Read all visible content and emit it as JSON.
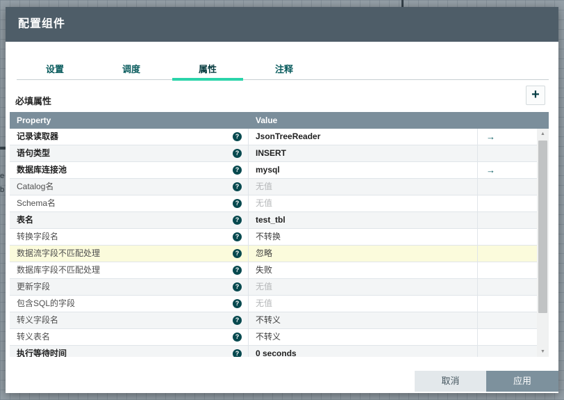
{
  "window": {
    "title": "配置组件"
  },
  "tabs": [
    {
      "id": "settings",
      "label": "设置",
      "active": false
    },
    {
      "id": "scheduling",
      "label": "调度",
      "active": false
    },
    {
      "id": "properties",
      "label": "属性",
      "active": true
    },
    {
      "id": "comments",
      "label": "注释",
      "active": false
    }
  ],
  "section": {
    "label": "必填属性",
    "add_button": "+"
  },
  "table": {
    "headers": [
      "Property",
      "Value"
    ],
    "rows": [
      {
        "name": "记录读取器",
        "bold": true,
        "value": "JsonTreeReader",
        "value_bold": true,
        "muted": false,
        "arrow": true,
        "highlight": false
      },
      {
        "name": "语句类型",
        "bold": true,
        "value": "INSERT",
        "value_bold": true,
        "muted": false,
        "arrow": false,
        "highlight": false
      },
      {
        "name": "数据库连接池",
        "bold": true,
        "value": "mysql",
        "value_bold": true,
        "muted": false,
        "arrow": true,
        "highlight": false
      },
      {
        "name": "Catalog名",
        "bold": false,
        "value": "无值",
        "value_bold": false,
        "muted": true,
        "arrow": false,
        "highlight": false
      },
      {
        "name": "Schema名",
        "bold": false,
        "value": "无值",
        "value_bold": false,
        "muted": true,
        "arrow": false,
        "highlight": false
      },
      {
        "name": "表名",
        "bold": true,
        "value": "test_tbl",
        "value_bold": true,
        "muted": false,
        "arrow": false,
        "highlight": false
      },
      {
        "name": "转换字段名",
        "bold": false,
        "value": "不转换",
        "value_bold": false,
        "muted": false,
        "arrow": false,
        "highlight": false
      },
      {
        "name": "数据流字段不匹配处理",
        "bold": false,
        "value": "忽略",
        "value_bold": false,
        "muted": false,
        "arrow": false,
        "highlight": true
      },
      {
        "name": "数据库字段不匹配处理",
        "bold": false,
        "value": "失败",
        "value_bold": false,
        "muted": false,
        "arrow": false,
        "highlight": false
      },
      {
        "name": "更新字段",
        "bold": false,
        "value": "无值",
        "value_bold": false,
        "muted": true,
        "arrow": false,
        "highlight": false
      },
      {
        "name": "包含SQL的字段",
        "bold": false,
        "value": "无值",
        "value_bold": false,
        "muted": true,
        "arrow": false,
        "highlight": false
      },
      {
        "name": "转义字段名",
        "bold": false,
        "value": "不转义",
        "value_bold": false,
        "muted": false,
        "arrow": false,
        "highlight": false
      },
      {
        "name": "转义表名",
        "bold": false,
        "value": "不转义",
        "value_bold": false,
        "muted": false,
        "arrow": false,
        "highlight": false
      },
      {
        "name": "执行等待时间",
        "bold": true,
        "value": "0 seconds",
        "value_bold": true,
        "muted": false,
        "arrow": false,
        "highlight": false
      }
    ]
  },
  "icons": {
    "help": "?",
    "arrow": "→",
    "add": "+",
    "scroll_up": "▲",
    "scroll_down": "▼"
  },
  "buttons": {
    "cancel": "取消",
    "apply": "应用"
  },
  "canvas_fragments": [
    "e",
    "b"
  ],
  "colors": {
    "dialog_header_bg": "#4e5d68",
    "table_header_bg": "#7b8e9b",
    "accent_teal": "#2bd4aa",
    "primary_teal": "#07494f",
    "highlight_row": "#fbfbdc",
    "alt_row": "#f3f5f6",
    "apply_button_bg": "#7d919d",
    "cancel_button_bg": "#e3e8eb",
    "backdrop": "#95a0a8"
  }
}
